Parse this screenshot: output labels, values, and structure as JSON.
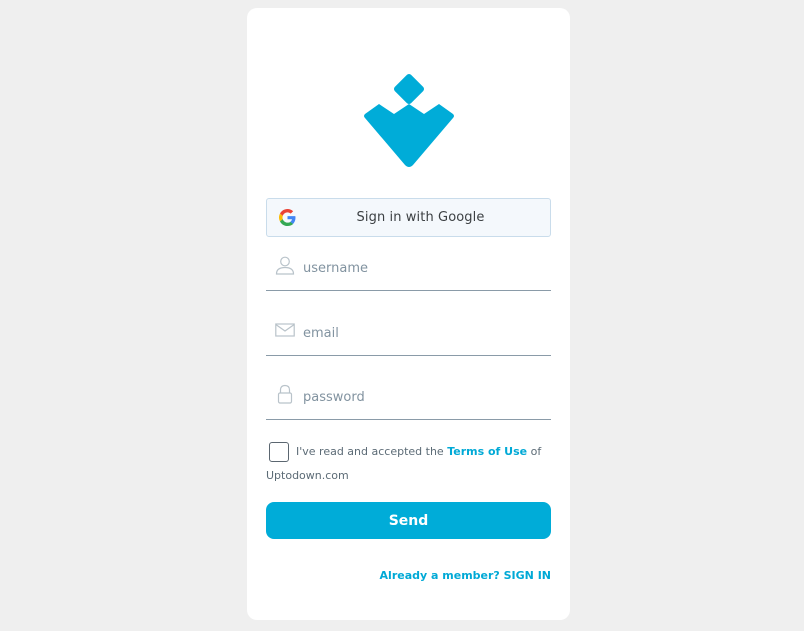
{
  "brand": {
    "logo_icon": "uptodown-logo-icon",
    "accent_color": "#00acd8"
  },
  "google": {
    "label": "Sign in with Google",
    "icon": "google-g-icon"
  },
  "fields": {
    "username": {
      "placeholder": "username",
      "icon": "user-icon"
    },
    "email": {
      "placeholder": "email",
      "icon": "envelope-icon"
    },
    "password": {
      "placeholder": "password",
      "icon": "lock-icon"
    }
  },
  "terms": {
    "prefix": "I've read and accepted the ",
    "link": "Terms of Use",
    "suffix": " of",
    "site": "Uptodown.com",
    "checked": false
  },
  "send": {
    "label": "Send"
  },
  "signin": {
    "label": "Already a member? SIGN IN"
  }
}
